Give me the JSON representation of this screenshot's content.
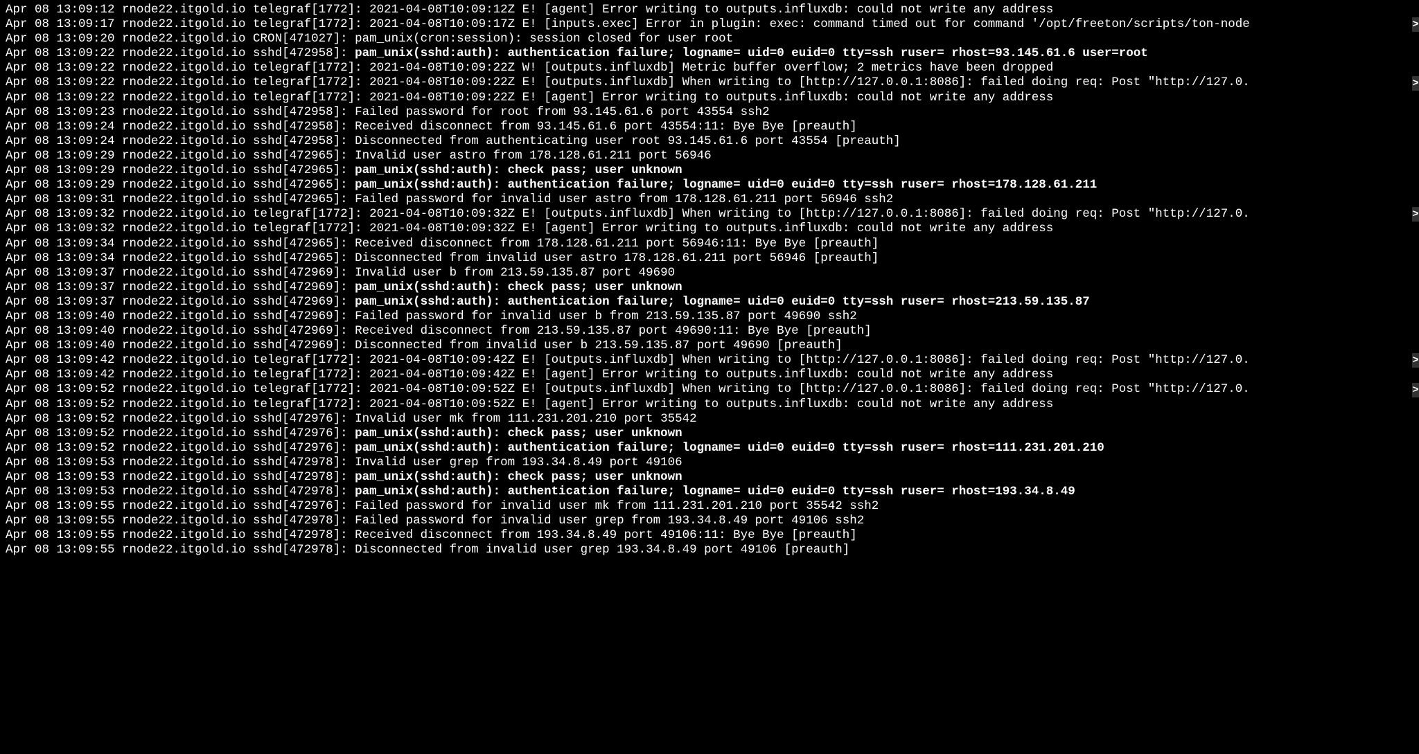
{
  "log_lines": [
    {
      "prefix": "Apr 08 13:09:12 rnode22.itgold.io telegraf[1772]: 2021-04-08T10:09:12Z E! [agent] Error writing to outputs.influxdb: could not write any address",
      "bold": "",
      "overflow": false
    },
    {
      "prefix": "Apr 08 13:09:17 rnode22.itgold.io telegraf[1772]: 2021-04-08T10:09:17Z E! [inputs.exec] Error in plugin: exec: command timed out for command '/opt/freeton/scripts/ton-node",
      "bold": "",
      "overflow": true
    },
    {
      "prefix": "Apr 08 13:09:20 rnode22.itgold.io CRON[471027]: pam_unix(cron:session): session closed for user root",
      "bold": "",
      "overflow": false
    },
    {
      "prefix": "Apr 08 13:09:22 rnode22.itgold.io sshd[472958]: ",
      "bold": "pam_unix(sshd:auth): authentication failure; logname= uid=0 euid=0 tty=ssh ruser= rhost=93.145.61.6  user=root",
      "overflow": false
    },
    {
      "prefix": "Apr 08 13:09:22 rnode22.itgold.io telegraf[1772]: 2021-04-08T10:09:22Z W! [outputs.influxdb] Metric buffer overflow; 2 metrics have been dropped",
      "bold": "",
      "overflow": false
    },
    {
      "prefix": "Apr 08 13:09:22 rnode22.itgold.io telegraf[1772]: 2021-04-08T10:09:22Z E! [outputs.influxdb] When writing to [http://127.0.0.1:8086]: failed doing req: Post \"http://127.0.",
      "bold": "",
      "overflow": true
    },
    {
      "prefix": "Apr 08 13:09:22 rnode22.itgold.io telegraf[1772]: 2021-04-08T10:09:22Z E! [agent] Error writing to outputs.influxdb: could not write any address",
      "bold": "",
      "overflow": false
    },
    {
      "prefix": "Apr 08 13:09:23 rnode22.itgold.io sshd[472958]: Failed password for root from 93.145.61.6 port 43554 ssh2",
      "bold": "",
      "overflow": false
    },
    {
      "prefix": "Apr 08 13:09:24 rnode22.itgold.io sshd[472958]: Received disconnect from 93.145.61.6 port 43554:11: Bye Bye [preauth]",
      "bold": "",
      "overflow": false
    },
    {
      "prefix": "Apr 08 13:09:24 rnode22.itgold.io sshd[472958]: Disconnected from authenticating user root 93.145.61.6 port 43554 [preauth]",
      "bold": "",
      "overflow": false
    },
    {
      "prefix": "Apr 08 13:09:29 rnode22.itgold.io sshd[472965]: Invalid user astro from 178.128.61.211 port 56946",
      "bold": "",
      "overflow": false
    },
    {
      "prefix": "Apr 08 13:09:29 rnode22.itgold.io sshd[472965]: ",
      "bold": "pam_unix(sshd:auth): check pass; user unknown",
      "overflow": false
    },
    {
      "prefix": "Apr 08 13:09:29 rnode22.itgold.io sshd[472965]: ",
      "bold": "pam_unix(sshd:auth): authentication failure; logname= uid=0 euid=0 tty=ssh ruser= rhost=178.128.61.211",
      "overflow": false
    },
    {
      "prefix": "Apr 08 13:09:31 rnode22.itgold.io sshd[472965]: Failed password for invalid user astro from 178.128.61.211 port 56946 ssh2",
      "bold": "",
      "overflow": false
    },
    {
      "prefix": "Apr 08 13:09:32 rnode22.itgold.io telegraf[1772]: 2021-04-08T10:09:32Z E! [outputs.influxdb] When writing to [http://127.0.0.1:8086]: failed doing req: Post \"http://127.0.",
      "bold": "",
      "overflow": true
    },
    {
      "prefix": "Apr 08 13:09:32 rnode22.itgold.io telegraf[1772]: 2021-04-08T10:09:32Z E! [agent] Error writing to outputs.influxdb: could not write any address",
      "bold": "",
      "overflow": false
    },
    {
      "prefix": "Apr 08 13:09:34 rnode22.itgold.io sshd[472965]: Received disconnect from 178.128.61.211 port 56946:11: Bye Bye [preauth]",
      "bold": "",
      "overflow": false
    },
    {
      "prefix": "Apr 08 13:09:34 rnode22.itgold.io sshd[472965]: Disconnected from invalid user astro 178.128.61.211 port 56946 [preauth]",
      "bold": "",
      "overflow": false
    },
    {
      "prefix": "Apr 08 13:09:37 rnode22.itgold.io sshd[472969]: Invalid user b from 213.59.135.87 port 49690",
      "bold": "",
      "overflow": false
    },
    {
      "prefix": "Apr 08 13:09:37 rnode22.itgold.io sshd[472969]: ",
      "bold": "pam_unix(sshd:auth): check pass; user unknown",
      "overflow": false
    },
    {
      "prefix": "Apr 08 13:09:37 rnode22.itgold.io sshd[472969]: ",
      "bold": "pam_unix(sshd:auth): authentication failure; logname= uid=0 euid=0 tty=ssh ruser= rhost=213.59.135.87",
      "overflow": false
    },
    {
      "prefix": "Apr 08 13:09:40 rnode22.itgold.io sshd[472969]: Failed password for invalid user b from 213.59.135.87 port 49690 ssh2",
      "bold": "",
      "overflow": false
    },
    {
      "prefix": "Apr 08 13:09:40 rnode22.itgold.io sshd[472969]: Received disconnect from 213.59.135.87 port 49690:11: Bye Bye [preauth]",
      "bold": "",
      "overflow": false
    },
    {
      "prefix": "Apr 08 13:09:40 rnode22.itgold.io sshd[472969]: Disconnected from invalid user b 213.59.135.87 port 49690 [preauth]",
      "bold": "",
      "overflow": false
    },
    {
      "prefix": "Apr 08 13:09:42 rnode22.itgold.io telegraf[1772]: 2021-04-08T10:09:42Z E! [outputs.influxdb] When writing to [http://127.0.0.1:8086]: failed doing req: Post \"http://127.0.",
      "bold": "",
      "overflow": true
    },
    {
      "prefix": "Apr 08 13:09:42 rnode22.itgold.io telegraf[1772]: 2021-04-08T10:09:42Z E! [agent] Error writing to outputs.influxdb: could not write any address",
      "bold": "",
      "overflow": false
    },
    {
      "prefix": "Apr 08 13:09:52 rnode22.itgold.io telegraf[1772]: 2021-04-08T10:09:52Z E! [outputs.influxdb] When writing to [http://127.0.0.1:8086]: failed doing req: Post \"http://127.0.",
      "bold": "",
      "overflow": true
    },
    {
      "prefix": "Apr 08 13:09:52 rnode22.itgold.io telegraf[1772]: 2021-04-08T10:09:52Z E! [agent] Error writing to outputs.influxdb: could not write any address",
      "bold": "",
      "overflow": false
    },
    {
      "prefix": "Apr 08 13:09:52 rnode22.itgold.io sshd[472976]: Invalid user mk from 111.231.201.210 port 35542",
      "bold": "",
      "overflow": false
    },
    {
      "prefix": "Apr 08 13:09:52 rnode22.itgold.io sshd[472976]: ",
      "bold": "pam_unix(sshd:auth): check pass; user unknown",
      "overflow": false
    },
    {
      "prefix": "Apr 08 13:09:52 rnode22.itgold.io sshd[472976]: ",
      "bold": "pam_unix(sshd:auth): authentication failure; logname= uid=0 euid=0 tty=ssh ruser= rhost=111.231.201.210",
      "overflow": false
    },
    {
      "prefix": "Apr 08 13:09:53 rnode22.itgold.io sshd[472978]: Invalid user grep from 193.34.8.49 port 49106",
      "bold": "",
      "overflow": false
    },
    {
      "prefix": "Apr 08 13:09:53 rnode22.itgold.io sshd[472978]: ",
      "bold": "pam_unix(sshd:auth): check pass; user unknown",
      "overflow": false
    },
    {
      "prefix": "Apr 08 13:09:53 rnode22.itgold.io sshd[472978]: ",
      "bold": "pam_unix(sshd:auth): authentication failure; logname= uid=0 euid=0 tty=ssh ruser= rhost=193.34.8.49",
      "overflow": false
    },
    {
      "prefix": "Apr 08 13:09:55 rnode22.itgold.io sshd[472976]: Failed password for invalid user mk from 111.231.201.210 port 35542 ssh2",
      "bold": "",
      "overflow": false
    },
    {
      "prefix": "Apr 08 13:09:55 rnode22.itgold.io sshd[472978]: Failed password for invalid user grep from 193.34.8.49 port 49106 ssh2",
      "bold": "",
      "overflow": false
    },
    {
      "prefix": "Apr 08 13:09:55 rnode22.itgold.io sshd[472978]: Received disconnect from 193.34.8.49 port 49106:11: Bye Bye [preauth]",
      "bold": "",
      "overflow": false
    },
    {
      "prefix": "Apr 08 13:09:55 rnode22.itgold.io sshd[472978]: Disconnected from invalid user grep 193.34.8.49 port 49106 [preauth]",
      "bold": "",
      "overflow": false
    }
  ],
  "overflow_char": ">"
}
